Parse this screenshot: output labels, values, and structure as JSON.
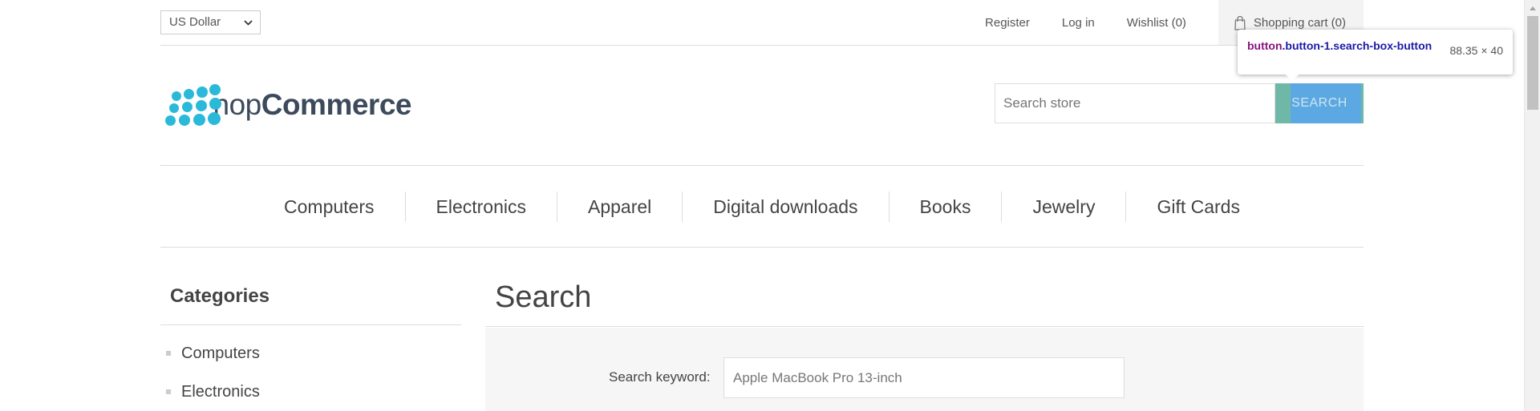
{
  "header": {
    "currency": "US Dollar",
    "links": {
      "register": "Register",
      "login": "Log in",
      "wishlist": "Wishlist (0)",
      "cart": "Shopping cart (0)"
    }
  },
  "tooltip": {
    "tag": "button",
    "selector": ".button-1.search-box-button",
    "dimensions": "88.35 × 40"
  },
  "logo": {
    "text_light": "nop",
    "text_bold": "Commerce"
  },
  "search": {
    "placeholder": "Search store",
    "button_label": "SEARCH"
  },
  "menu": {
    "items": [
      "Computers",
      "Electronics",
      "Apparel",
      "Digital downloads",
      "Books",
      "Jewelry",
      "Gift Cards"
    ]
  },
  "sidebar": {
    "title": "Categories",
    "items": [
      "Computers",
      "Electronics"
    ]
  },
  "main": {
    "title": "Search",
    "keyword_label": "Search keyword:",
    "keyword_value": "Apple MacBook Pro 13-inch"
  },
  "colors": {
    "accent": "#4ab2f1",
    "logo": "#2bb9d9",
    "search_button": "#6fb8a8",
    "highlight": "#5ba7e5"
  }
}
